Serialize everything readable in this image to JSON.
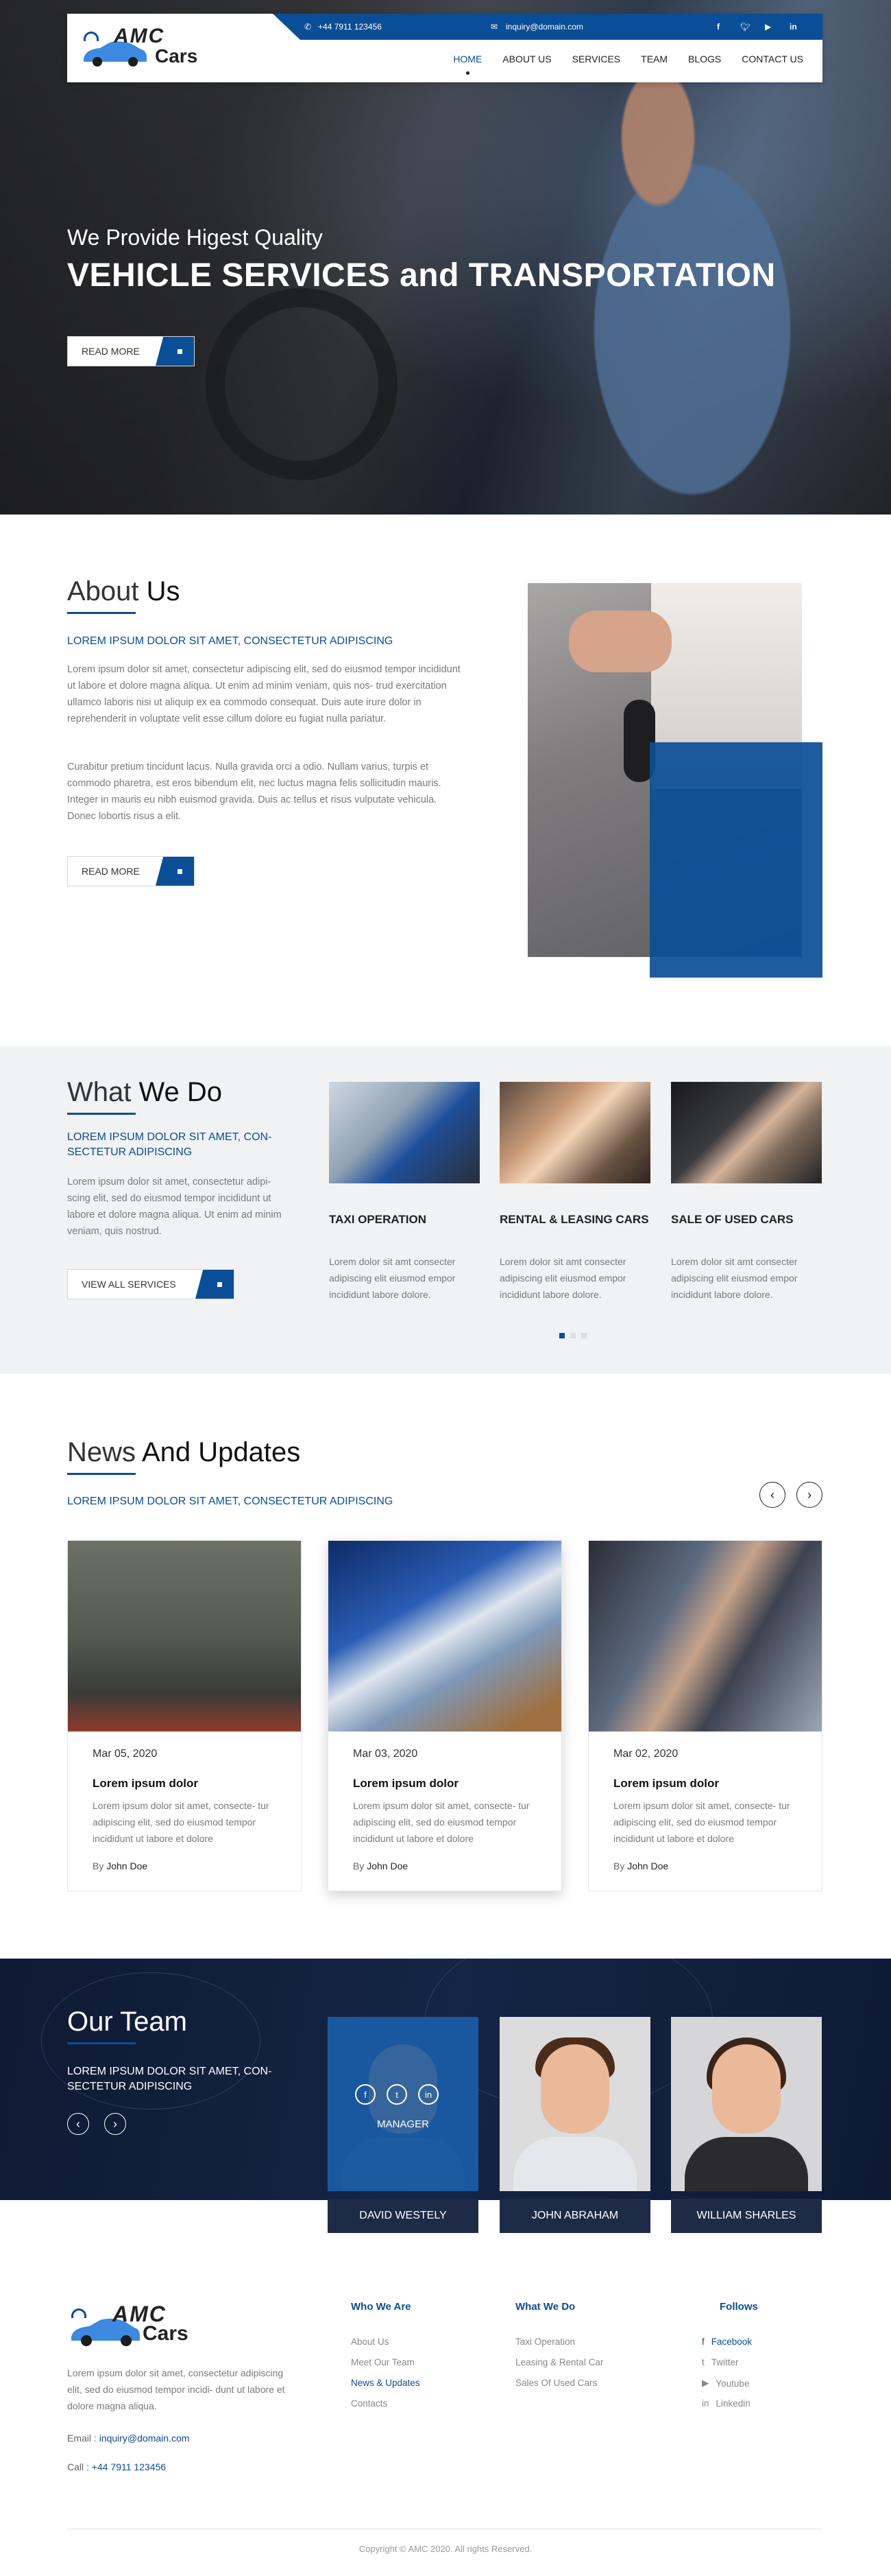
{
  "header": {
    "phone": "+44 7911 123456",
    "email": "inquiry@domain.com",
    "social": [
      "f",
      "t",
      "yt",
      "in"
    ],
    "logo_top": "AMC",
    "logo_bottom": "Cars",
    "nav": [
      "HOME",
      "ABOUT US",
      "SERVICES",
      "TEAM",
      "BLOGS",
      "CONTACT US"
    ],
    "nav_active": "HOME",
    "icons": [
      "phone-icon",
      "mail-icon",
      "facebook-icon",
      "twitter-icon",
      "youtube-icon",
      "linkedin-icon"
    ]
  },
  "hero": {
    "subtitle": "We Provide Higest Quality",
    "title": "VEHICLE SERVICES and TRANSPORTATION",
    "button": "READ MORE"
  },
  "about": {
    "title_light": "About",
    "title_bold": "Us",
    "lead": "LOREM IPSUM DOLOR SIT AMET, CONSECTETUR ADIPISCING",
    "p1": "Lorem ipsum dolor sit amet, consectetur adipiscing elit, sed do eiusmod tempor incididunt ut labore et dolore magna aliqua. Ut enim ad minim veniam, quis nos- trud exercitation ullamco laboris nisi ut aliquip ex ea commodo consequat. Duis aute irure dolor in reprehenderit in voluptate velit esse cillum dolore eu fugiat nulla pariatur.",
    "p2": "Curabitur pretium tincidunt lacus. Nulla gravida orci a odio. Nullam varius, turpis et commodo pharetra, est eros bibendum elit, nec luctus magna felis sollicitudin mauris. Integer in mauris eu nibh euismod gravida. Duis ac tellus et risus vulputate vehicula. Donec lobortis risus a elit.",
    "button": "READ MORE"
  },
  "whatwedo": {
    "title_light": "What",
    "title_bold": "We Do",
    "lead": "LOREM IPSUM DOLOR SIT AMET, CON- SECTETUR ADIPISCING",
    "text": "Lorem ipsum dolor sit amet, consectetur adipi- scing elit, sed do eiusmod tempor incididunt ut labore et dolore magna aliqua. Ut enim ad minim veniam, quis nostrud.",
    "button": "VIEW ALL SERVICES",
    "services": [
      {
        "title": "TAXI OPERATION",
        "text": "Lorem  dolor sit amt consecter adipiscing elit  eiusmod empor incididunt labore dolore."
      },
      {
        "title": "RENTAL & LEASING CARS",
        "text": "Lorem  dolor sit amt consecter adipiscing elit  eiusmod empor incididunt labore dolore."
      },
      {
        "title": "SALE OF USED CARS",
        "text": "Lorem  dolor sit amt consecter adipiscing elit  eiusmod empor incididunt labore dolore."
      }
    ]
  },
  "news": {
    "title_light": "News",
    "title_bold": "And Updates",
    "lead": "LOREM IPSUM DOLOR SIT AMET, CONSECTETUR ADIPISCING",
    "prev": "‹",
    "next": "›",
    "items": [
      {
        "date": "Mar 05, 2020",
        "title": "Lorem ipsum dolor",
        "text": "Lorem ipsum dolor sit amet, consecte- tur adipiscing elit, sed do eiusmod tempor incididunt ut labore et dolore",
        "by": "By",
        "author": "John Doe"
      },
      {
        "date": "Mar 03, 2020",
        "title": "Lorem ipsum dolor",
        "text": "Lorem ipsum dolor sit amet, consecte- tur adipiscing elit, sed do eiusmod tempor incididunt ut labore et dolore",
        "by": "By",
        "author": "John Doe"
      },
      {
        "date": "Mar 02, 2020",
        "title": "Lorem ipsum dolor",
        "text": "Lorem ipsum dolor sit amet, consecte- tur adipiscing elit, sed do eiusmod tempor incididunt ut labore et dolore",
        "by": "By",
        "author": "John Doe"
      }
    ]
  },
  "team": {
    "title_light": "Our",
    "title_bold": "Team",
    "lead": "LOREM IPSUM DOLOR SIT AMET, CON- SECTETUR ADIPISCING",
    "role": "MANAGER",
    "members": [
      "DAVID WESTELY",
      "JOHN ABRAHAM",
      "WILLIAM SHARLES"
    ],
    "prev": "‹",
    "next": "›"
  },
  "footer": {
    "logo_top": "AMC",
    "logo_bottom": "Cars",
    "about": "Lorem ipsum dolor sit amet, consectetur adipiscing elit, sed do eiusmod tempor incidi- dunt ut labore et dolore magna aliqua.",
    "email_label": "Email :",
    "email": "inquiry@domain.com",
    "call_label": "Call :",
    "phone": "+44 7911 123456",
    "col1_title": "Who We Are",
    "col1": [
      "About Us",
      "Meet Our Team",
      "News & Updates",
      "Contacts"
    ],
    "col2_title": "What We Do",
    "col2": [
      "Taxi Operation",
      "Leasing & Rental Car",
      "Sales Of Used Cars"
    ],
    "col3_title": "Follows",
    "col3": [
      "Facebook",
      "Twitter",
      "Youtube",
      "Linkedin"
    ],
    "copyright": "Copyright © AMC 2020. All rights Reserved."
  },
  "colors": {
    "brand": "#0a4e97",
    "dark": "#0f1a33",
    "light_bg": "#f1f2f4"
  }
}
